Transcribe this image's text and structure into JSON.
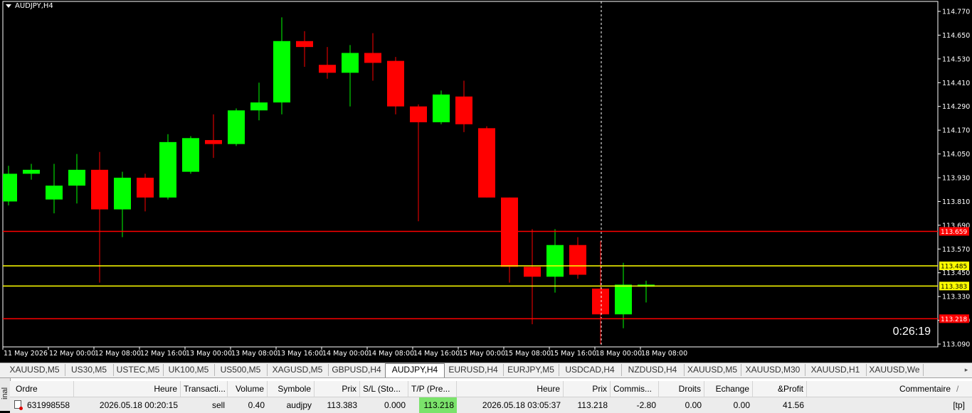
{
  "chart": {
    "symbol_label": "AUDJPY,H4",
    "countdown": "0:26:19",
    "price_axis": [
      "114.770",
      "114.650",
      "114.530",
      "114.410",
      "114.290",
      "114.170",
      "114.050",
      "113.930",
      "113.810",
      "113.690",
      "113.570",
      "113.450",
      "113.330",
      "113.210",
      "113.090"
    ],
    "time_axis": [
      "11 May 2026",
      "12 May 00:00",
      "12 May 08:00",
      "12 May 16:00",
      "13 May 00:00",
      "13 May 08:00",
      "13 May 16:00",
      "14 May 00:00",
      "14 May 08:00",
      "14 May 16:00",
      "15 May 00:00",
      "15 May 08:00",
      "15 May 16:00",
      "18 May 00:00",
      "18 May 08:00"
    ],
    "levels": [
      {
        "price": 113.659,
        "label": "113.659",
        "color": "#ff0000"
      },
      {
        "price": 113.485,
        "label": "113.485",
        "color": "#ffff00"
      },
      {
        "price": 113.383,
        "label": "113.383",
        "color": "#ffff00"
      },
      {
        "price": 113.218,
        "label": "113.218",
        "color": "#ff0000"
      }
    ],
    "bull_color": "#00ff00",
    "bear_color": "#ff0000"
  },
  "chart_data": {
    "type": "candlestick",
    "ylim": [
      113.06,
      114.8
    ],
    "candles": [
      {
        "o": 113.81,
        "h": 113.99,
        "l": 113.79,
        "c": 113.95
      },
      {
        "o": 113.95,
        "h": 114.0,
        "l": 113.92,
        "c": 113.97
      },
      {
        "o": 113.82,
        "h": 114.0,
        "l": 113.75,
        "c": 113.89
      },
      {
        "o": 113.89,
        "h": 114.05,
        "l": 113.8,
        "c": 113.97
      },
      {
        "o": 113.97,
        "h": 114.06,
        "l": 113.4,
        "c": 113.77
      },
      {
        "o": 113.77,
        "h": 113.96,
        "l": 113.63,
        "c": 113.93
      },
      {
        "o": 113.93,
        "h": 113.95,
        "l": 113.76,
        "c": 113.83
      },
      {
        "o": 113.83,
        "h": 114.15,
        "l": 113.82,
        "c": 114.11
      },
      {
        "o": 113.96,
        "h": 114.14,
        "l": 113.95,
        "c": 114.13
      },
      {
        "o": 114.12,
        "h": 114.25,
        "l": 114.03,
        "c": 114.1
      },
      {
        "o": 114.1,
        "h": 114.28,
        "l": 114.09,
        "c": 114.27
      },
      {
        "o": 114.27,
        "h": 114.41,
        "l": 114.22,
        "c": 114.31
      },
      {
        "o": 114.31,
        "h": 114.74,
        "l": 114.25,
        "c": 114.62
      },
      {
        "o": 114.62,
        "h": 114.67,
        "l": 114.49,
        "c": 114.59
      },
      {
        "o": 114.5,
        "h": 114.59,
        "l": 114.43,
        "c": 114.46
      },
      {
        "o": 114.46,
        "h": 114.6,
        "l": 114.29,
        "c": 114.56
      },
      {
        "o": 114.56,
        "h": 114.66,
        "l": 114.42,
        "c": 114.51
      },
      {
        "o": 114.52,
        "h": 114.54,
        "l": 114.25,
        "c": 114.29
      },
      {
        "o": 114.29,
        "h": 114.3,
        "l": 113.71,
        "c": 114.21
      },
      {
        "o": 114.21,
        "h": 114.37,
        "l": 114.2,
        "c": 114.35
      },
      {
        "o": 114.34,
        "h": 114.42,
        "l": 114.16,
        "c": 114.2
      },
      {
        "o": 114.18,
        "h": 114.19,
        "l": 113.83,
        "c": 113.83
      },
      {
        "o": 113.83,
        "h": 113.83,
        "l": 113.4,
        "c": 113.48
      },
      {
        "o": 113.48,
        "h": 113.67,
        "l": 113.19,
        "c": 113.43
      },
      {
        "o": 113.43,
        "h": 113.67,
        "l": 113.35,
        "c": 113.59
      },
      {
        "o": 113.59,
        "h": 113.63,
        "l": 113.42,
        "c": 113.44
      },
      {
        "o": 113.37,
        "h": 113.61,
        "l": 113.09,
        "c": 113.24
      },
      {
        "o": 113.24,
        "h": 113.5,
        "l": 113.17,
        "c": 113.39
      },
      {
        "o": 113.38,
        "h": 113.41,
        "l": 113.3,
        "c": 113.39
      }
    ]
  },
  "tabs": [
    "XAUUSD,M5",
    "US30,M5",
    "USTEC,M5",
    "UK100,M5",
    "US500,M5",
    "XAGUSD,M5",
    "GBPUSD,H4",
    "AUDJPY,H4",
    "EURUSD,H4",
    "EURJPY,M5",
    "USDCAD,H4",
    "NZDUSD,H4",
    "XAUUSD,M5",
    "XAUUSD,M30",
    "XAUUSD,H1",
    "XAUUSD,We"
  ],
  "active_tab": "AUDJPY,H4",
  "terminal": {
    "side_label": "inal",
    "headers": {
      "ordre": "Ordre",
      "heure": "Heure",
      "transaction": "Transacti...",
      "volume": "Volume",
      "symbole": "Symbole",
      "prix": "Prix",
      "sl": "S/L (Sto...",
      "tp": "T/P (Pre...",
      "heure2": "Heure",
      "prix2": "Prix",
      "commission": "Commis...",
      "droits": "Droits",
      "echange": "Echange",
      "profit": "&Profit",
      "commentaire": "Commentaire",
      "sort_indicator": "/"
    },
    "row": {
      "ordre": "631998558",
      "heure": "2026.05.18 00:20:15",
      "transaction": "sell",
      "volume": "0.40",
      "symbole": "audjpy",
      "prix": "113.383",
      "sl": "0.000",
      "tp": "113.218",
      "heure2": "2026.05.18 03:05:37",
      "prix2": "113.218",
      "commission": "-2.80",
      "droits": "0.00",
      "echange": "0.00",
      "profit": "41.56",
      "commentaire": "[tp]"
    }
  }
}
